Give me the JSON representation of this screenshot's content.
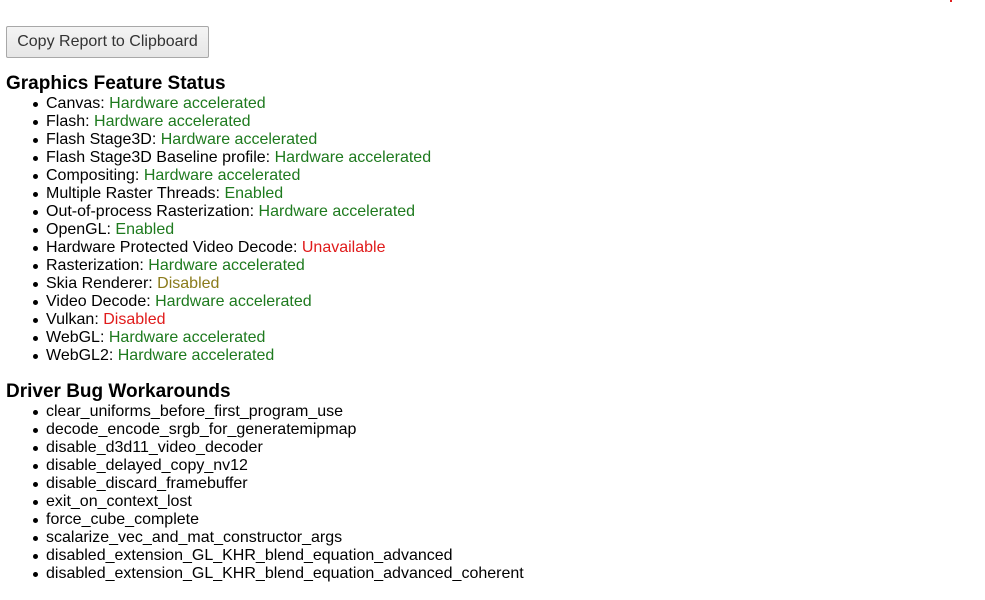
{
  "colors": {
    "good": "#1e7a1e",
    "bad": "#e01b1b",
    "warn": "#8a7a1a"
  },
  "copy_button_label": "Copy Report to Clipboard",
  "graphics_feature_status": {
    "title": "Graphics Feature Status",
    "items": [
      {
        "feature": "Canvas:",
        "status": "Hardware accelerated",
        "level": "good"
      },
      {
        "feature": "Flash:",
        "status": "Hardware accelerated",
        "level": "good"
      },
      {
        "feature": "Flash Stage3D:",
        "status": "Hardware accelerated",
        "level": "good"
      },
      {
        "feature": "Flash Stage3D Baseline profile:",
        "status": "Hardware accelerated",
        "level": "good"
      },
      {
        "feature": "Compositing:",
        "status": "Hardware accelerated",
        "level": "good"
      },
      {
        "feature": "Multiple Raster Threads:",
        "status": "Enabled",
        "level": "good"
      },
      {
        "feature": "Out-of-process Rasterization:",
        "status": "Hardware accelerated",
        "level": "good"
      },
      {
        "feature": "OpenGL:",
        "status": "Enabled",
        "level": "good"
      },
      {
        "feature": "Hardware Protected Video Decode:",
        "status": "Unavailable",
        "level": "bad"
      },
      {
        "feature": "Rasterization:",
        "status": "Hardware accelerated",
        "level": "good"
      },
      {
        "feature": "Skia Renderer:",
        "status": "Disabled",
        "level": "warn"
      },
      {
        "feature": "Video Decode:",
        "status": "Hardware accelerated",
        "level": "good"
      },
      {
        "feature": "Vulkan:",
        "status": "Disabled",
        "level": "bad"
      },
      {
        "feature": "WebGL:",
        "status": "Hardware accelerated",
        "level": "good"
      },
      {
        "feature": "WebGL2:",
        "status": "Hardware accelerated",
        "level": "good"
      }
    ]
  },
  "driver_bug_workarounds": {
    "title": "Driver Bug Workarounds",
    "items": [
      "clear_uniforms_before_first_program_use",
      "decode_encode_srgb_for_generatemipmap",
      "disable_d3d11_video_decoder",
      "disable_delayed_copy_nv12",
      "disable_discard_framebuffer",
      "exit_on_context_lost",
      "force_cube_complete",
      "scalarize_vec_and_mat_constructor_args",
      "disabled_extension_GL_KHR_blend_equation_advanced",
      "disabled_extension_GL_KHR_blend_equation_advanced_coherent"
    ]
  }
}
